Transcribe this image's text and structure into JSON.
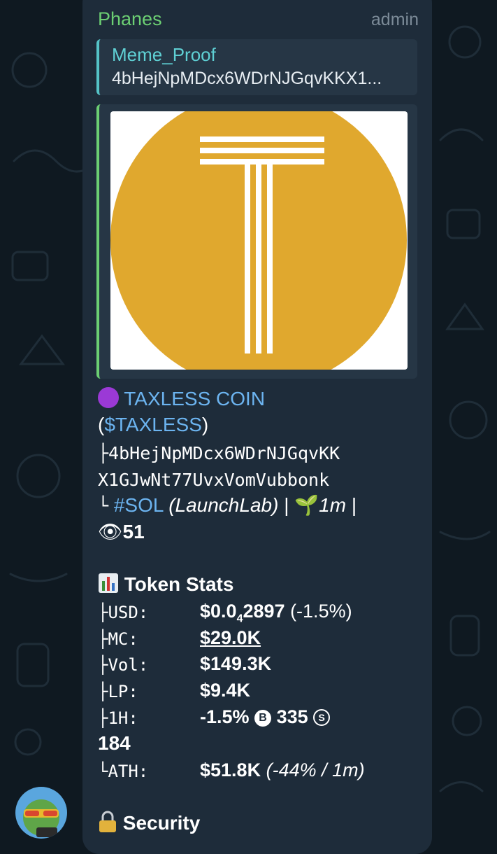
{
  "message": {
    "sender": "Phanes",
    "badge": "admin",
    "reply": {
      "name": "Meme_Proof",
      "text": "4bHejNpMDcx6WDrNJGqvKKX1..."
    },
    "token": {
      "name": "TAXLESS COIN",
      "ticker_open": "(",
      "ticker": "$TAXLESS",
      "ticker_close": ")",
      "address_line1": "├4bHejNpMDcx6WDrNJGqvKK",
      "address_line2": "X1GJwNt77UvxVomVubbonk",
      "tree_end": "└",
      "chain": "#SOL",
      "platform": "(LaunchLab)",
      "sep": "|",
      "age": "1m",
      "sep2": "|",
      "views": "51"
    },
    "stats": {
      "title": "Token Stats",
      "usd_label": "├USD:",
      "usd_value_prefix": "$0.0",
      "usd_value_sub": "4",
      "usd_value_suffix": "2897",
      "usd_change": "(-1.5%)",
      "mc_label": "├MC:",
      "mc_value": "$29.0K",
      "vol_label": "├Vol:",
      "vol_value": "$149.3K",
      "lp_label": "├LP:",
      "lp_value": "$9.4K",
      "h1_label": "├1H:",
      "h1_change": "-1.5%",
      "buys_icon": "B",
      "buys": "335",
      "sells_icon": "S",
      "sells": "184",
      "ath_label": "└ATH:",
      "ath_value": "$51.8K",
      "ath_note": "(-44% / 1m)"
    },
    "security": {
      "title": "Security"
    }
  },
  "icons": {
    "purple_circle": "purple-circle-icon",
    "seedling": "seedling-icon",
    "eye": "eye-icon",
    "chart": "bar-chart-icon",
    "lock": "lock-icon"
  },
  "colors": {
    "background": "#0f1921",
    "bubble": "#1e2c3a",
    "sender": "#6ccf73",
    "link": "#6cb4f0",
    "coin": "#e0a82e"
  }
}
